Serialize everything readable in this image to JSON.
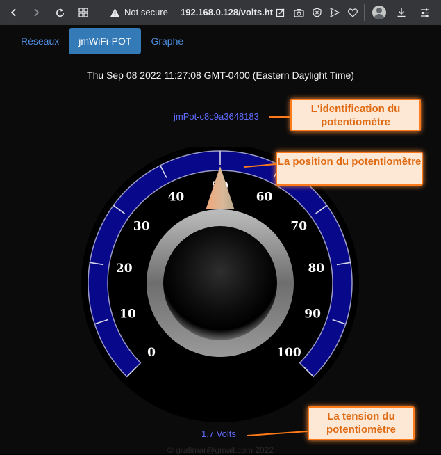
{
  "browser": {
    "security_label": "Not secure",
    "url": "192.168.0.128/volts.ht"
  },
  "nav": {
    "tabs": [
      {
        "label": "Réseaux",
        "active": false
      },
      {
        "label": "jmWiFi-POT",
        "active": true
      },
      {
        "label": "Graphe",
        "active": false
      }
    ]
  },
  "datetime": "Thu Sep 08 2022 11:27:08 GMT-0400 (Eastern Daylight Time)",
  "device_id": "jmPot-c8c9a3648183",
  "voltage_text": "1.7 Volts",
  "gauge": {
    "position_value": 50,
    "min": 0,
    "max": 100,
    "scale_labels": [
      "0",
      "10",
      "20",
      "30",
      "40",
      "50",
      "60",
      "70",
      "80",
      "90",
      "100"
    ],
    "colors": {
      "ring": "#08088a",
      "needle": "#e8b896",
      "knob": "#8a8a8a"
    }
  },
  "callouts": {
    "identification": "L'identification du potentiomètre",
    "position": "La position du potentiomètre",
    "tension": "La tension du potentiomètre"
  },
  "footer": "© grafimar@gmail.com 2022"
}
